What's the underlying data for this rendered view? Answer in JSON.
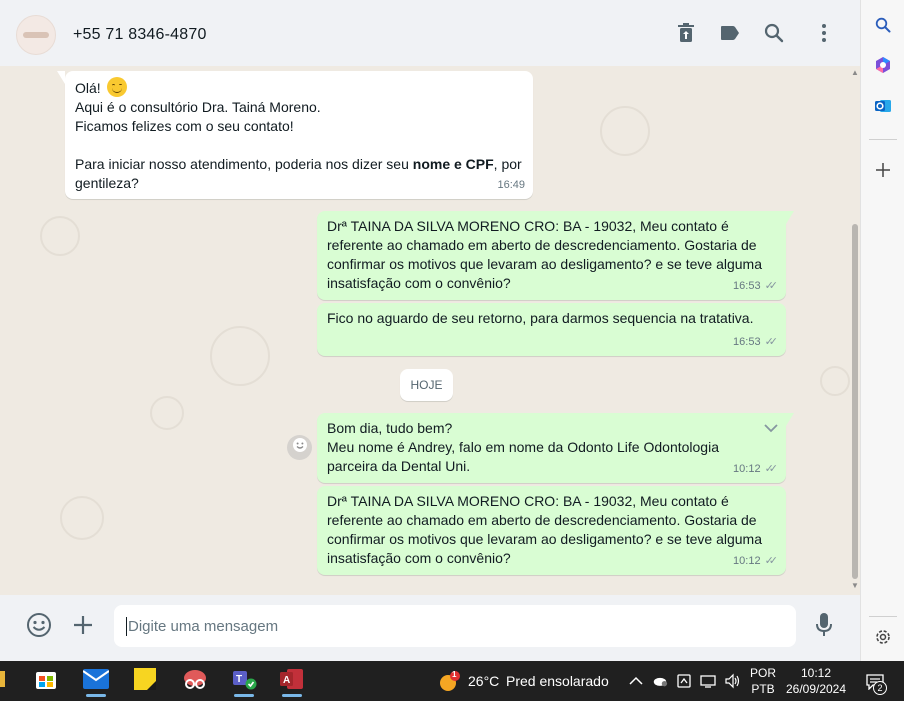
{
  "header": {
    "contact_name": "+55 71 8346-4870"
  },
  "messages": [
    {
      "direction": "in",
      "lines": [
        "Olá!",
        "Aqui é o consultório Dra. Tainá Moreno.",
        "Ficamos felizes com o seu contato!",
        "",
        "Para iniciar nosso atendimento, poderia nos dizer seu",
        "nome e CPF",
        ", por",
        "gentileza?"
      ],
      "time": "16:49"
    },
    {
      "direction": "out",
      "lines": [
        "Drª TAINA DA SILVA MORENO CRO: BA - 19032, Meu contato é",
        "referente ao chamado em aberto de descredenciamento. Gostaria de",
        "confirmar os motivos que levaram ao desligamento? e se teve alguma",
        "insatisfação com o convênio?"
      ],
      "time": "16:53"
    },
    {
      "direction": "out",
      "lines": [
        "Fico no aguardo de seu retorno, para darmos sequencia na tratativa."
      ],
      "time": "16:53"
    },
    {
      "direction": "out",
      "lines": [
        "Bom dia, tudo bem?",
        "Meu nome é Andrey, falo em nome da Odonto Life Odontologia",
        "parceira da Dental Uni."
      ],
      "time": "10:12"
    },
    {
      "direction": "out",
      "lines": [
        "Drª TAINA DA SILVA MORENO CRO: BA - 19032, Meu contato é",
        "referente ao chamado em aberto de descredenciamento. Gostaria de",
        "confirmar os motivos que levaram ao desligamento? e se teve alguma",
        "insatisfação com o convênio?"
      ],
      "time": "10:12"
    }
  ],
  "date_divider": "HOJE",
  "composer": {
    "placeholder": "Digite uma mensagem"
  },
  "taskbar": {
    "weather_temp": "26°C",
    "weather_desc": "Pred ensolarado",
    "weather_badge": "1",
    "lang_line1": "POR",
    "lang_line2": "PTB",
    "time": "10:12",
    "date": "26/09/2024",
    "notif_count": "2"
  },
  "icons": {
    "header": [
      "delete-icon",
      "label-icon",
      "search-icon",
      "menu-icon"
    ],
    "right_strip": [
      "search-icon",
      "copilot-icon",
      "outlook-icon",
      "add-icon",
      "settings-icon"
    ],
    "composer": [
      "emoji-icon",
      "attach-icon",
      "mic-icon"
    ]
  },
  "colors": {
    "outgoing_bubble": "#d9fdd3",
    "incoming_bubble": "#ffffff",
    "chat_background": "#efeae2",
    "header_background": "#f0f2f5",
    "taskbar": "#202020"
  }
}
